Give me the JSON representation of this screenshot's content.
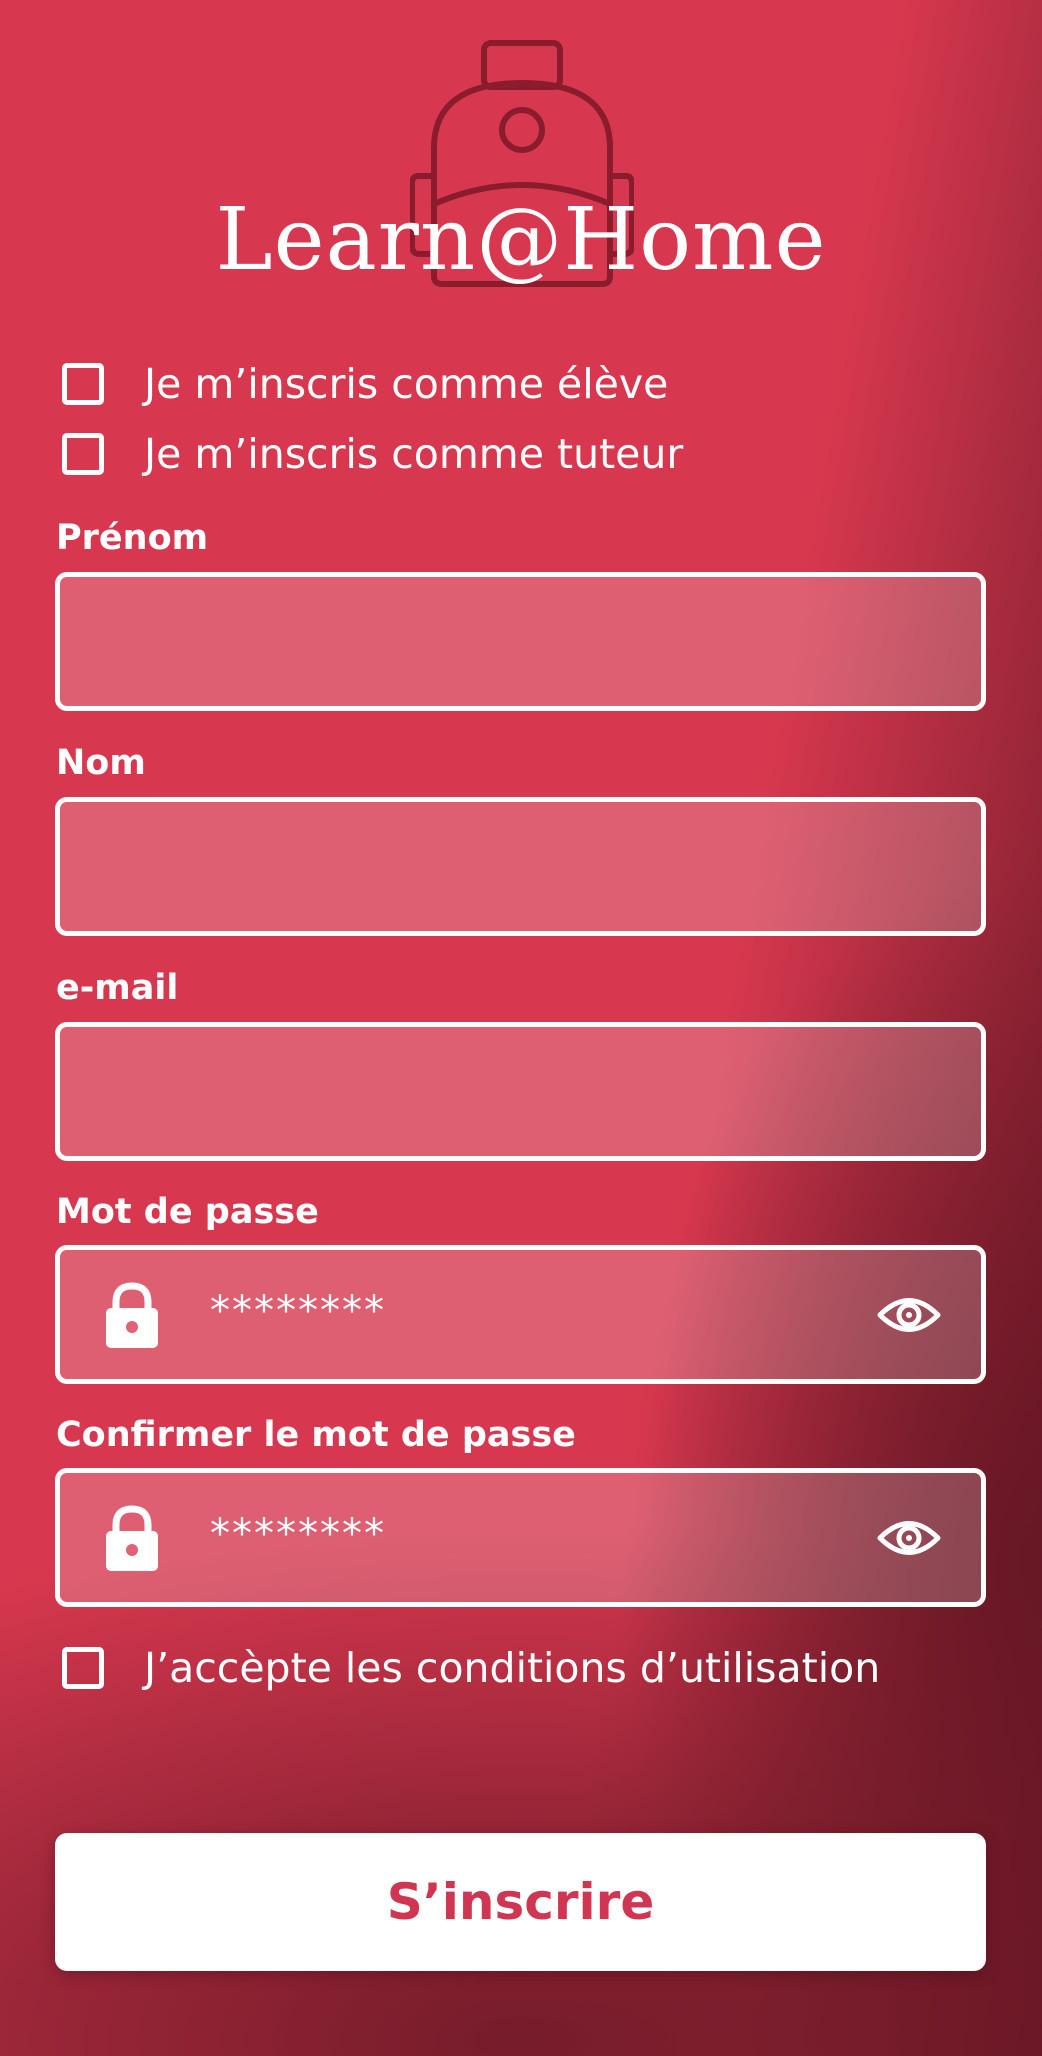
{
  "app": {
    "title": "Learn@Home",
    "logo_icon": "backpack-icon"
  },
  "roles": {
    "student_label": "Je m’inscris comme élève",
    "tutor_label": "Je m’inscris comme tuteur",
    "student_checked": false,
    "tutor_checked": false
  },
  "fields": {
    "first_name": {
      "label": "Prénom",
      "value": ""
    },
    "last_name": {
      "label": "Nom",
      "value": ""
    },
    "email": {
      "label": "e-mail",
      "value": ""
    },
    "password": {
      "label": "Mot de passe",
      "value": "********",
      "icon": "lock-icon",
      "toggle_icon": "eye-icon"
    },
    "password_confirm": {
      "label": "Confirmer le mot de passe",
      "value": "********",
      "icon": "lock-icon",
      "toggle_icon": "eye-icon"
    }
  },
  "terms": {
    "label": "J’accèpte les conditions d’utilisation",
    "checked": false
  },
  "submit": {
    "label": "S’inscrire"
  },
  "colors": {
    "background": "#d8384f",
    "background_dark": "#6d1a28",
    "input_fill": "#e06275",
    "accent_text": "#d03651",
    "foreground": "#ffffff",
    "logo_stroke": "#8a1c2e"
  }
}
